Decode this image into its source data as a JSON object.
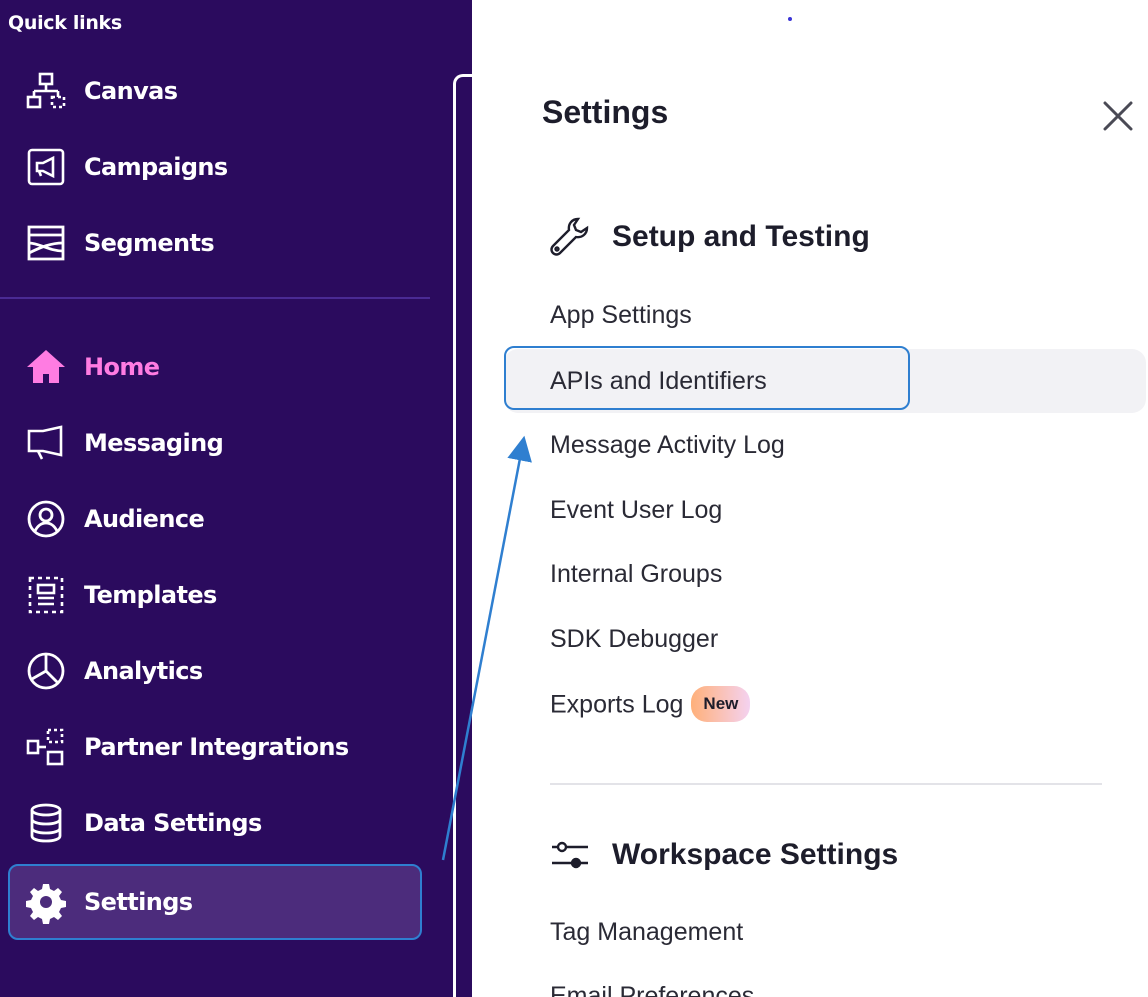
{
  "sidebar": {
    "quick_links_title": "Quick links",
    "quick_links": [
      {
        "label": "Canvas",
        "icon": "canvas-icon"
      },
      {
        "label": "Campaigns",
        "icon": "campaigns-icon"
      },
      {
        "label": "Segments",
        "icon": "segments-icon"
      }
    ],
    "nav": [
      {
        "label": "Home",
        "icon": "home-icon",
        "active": true
      },
      {
        "label": "Messaging",
        "icon": "messaging-icon"
      },
      {
        "label": "Audience",
        "icon": "audience-icon"
      },
      {
        "label": "Templates",
        "icon": "templates-icon"
      },
      {
        "label": "Analytics",
        "icon": "analytics-icon"
      },
      {
        "label": "Partner Integrations",
        "icon": "partner-integrations-icon"
      },
      {
        "label": "Data Settings",
        "icon": "data-settings-icon"
      },
      {
        "label": "Settings",
        "icon": "settings-gear-icon",
        "selected": true
      }
    ]
  },
  "settings_panel": {
    "title": "Settings",
    "sections": [
      {
        "title": "Setup and Testing",
        "icon": "wrench-icon",
        "links": [
          "App Settings",
          "APIs and Identifiers",
          "Message Activity Log",
          "Event User Log",
          "Internal Groups",
          "SDK Debugger",
          "Exports Log"
        ],
        "badge": "New"
      },
      {
        "title": "Workspace Settings",
        "icon": "sliders-icon",
        "links": [
          "Tag Management",
          "Email Preferences"
        ]
      }
    ]
  },
  "colors": {
    "sidebar_bg": "#2b0b5e",
    "active_accent": "#ff7ce2",
    "highlight_outline": "#2f7fd0",
    "selected_bg": "#4c2c7c"
  }
}
